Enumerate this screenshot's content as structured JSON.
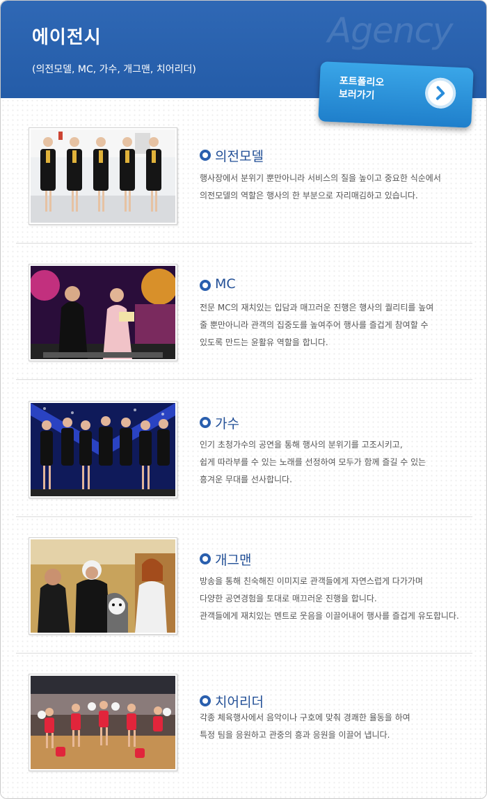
{
  "header": {
    "title": "에이전시",
    "subtitle": "(의전모델, MC, 가수, 개그맨, 치어리더)",
    "watermark": "Agency",
    "portfolio_button": "포트폴리오\n보러가기",
    "colors": {
      "header_blue": "#2f68b5",
      "button_blue": "#2a8ddb",
      "title_blue": "#224f96"
    }
  },
  "items": [
    {
      "title": "의전모델",
      "description": "행사장에서 분위기 뿐만아니라 서비스의 질을 높이고 중요한 식순에서\n의전모델의 역할은 행사의 한 부분으로 자리매김하고 있습니다.",
      "image_icon": "usher-models-photo"
    },
    {
      "title": "MC",
      "description": "전문 MC의 재치있는 입담과 매끄러운 진행은 행사의 퀄리티를 높여\n줄 뿐만아니라 관객의 집중도를 높여주어 행사를 즐겁게 참여할 수\n있도록 만드는 윤활유 역할을 합니다.",
      "image_icon": "mc-hosts-photo"
    },
    {
      "title": "가수",
      "description": "인기 초청가수의 공연을 통해 행사의 분위기를 고조시키고,\n쉽게 따라부를 수 있는 노래를 선정하여 모두가 함께 즐길 수 있는\n흥겨운 무대를 선사합니다.",
      "image_icon": "singers-stage-photo"
    },
    {
      "title": "개그맨",
      "description": "방송을 통해 친숙해진 이미지로 관객들에게 자연스럽게 다가가며\n다양한 공연경험을 토대로 매끄러운 진행을 합니다.\n관객들에게 재치있는 멘트로 웃음을 이끌어내어 행사를 즐겁게 유도합니다.",
      "image_icon": "comedians-photo"
    },
    {
      "title": "치어리더",
      "description": "각종 체육행사에서 음악이나 구호에 맞춰 경쾌한 율동을 하여\n특정 팀을 응원하고 관중의 흥과 응원을 이끌어 냅니다.",
      "image_icon": "cheerleaders-photo"
    }
  ]
}
